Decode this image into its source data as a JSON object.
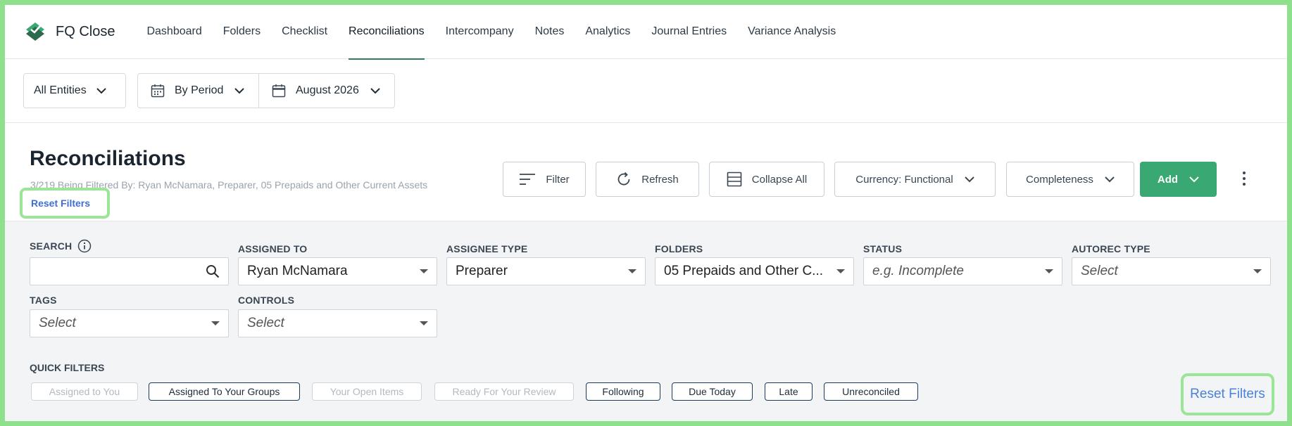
{
  "app": {
    "name": "FQ Close"
  },
  "nav": {
    "items": [
      {
        "label": "Dashboard"
      },
      {
        "label": "Folders"
      },
      {
        "label": "Checklist"
      },
      {
        "label": "Reconciliations"
      },
      {
        "label": "Intercompany"
      },
      {
        "label": "Notes"
      },
      {
        "label": "Analytics"
      },
      {
        "label": "Journal Entries"
      },
      {
        "label": "Variance Analysis"
      }
    ],
    "active": "Reconciliations"
  },
  "period_bar": {
    "entities": "All Entities",
    "mode": "By Period",
    "period": "August 2026"
  },
  "header": {
    "title": "Reconciliations",
    "filtered_by": "3/219 Being Filtered By: Ryan McNamara, Preparer, 05 Prepaids and Other Current Assets",
    "reset_filters": "Reset Filters"
  },
  "toolbar": {
    "filter": "Filter",
    "refresh": "Refresh",
    "collapse_all": "Collapse All",
    "currency": "Currency: Functional",
    "completeness": "Completeness",
    "add": "Add"
  },
  "filters": {
    "search": {
      "label": "SEARCH",
      "value": ""
    },
    "assigned_to": {
      "label": "ASSIGNED TO",
      "value": "Ryan McNamara"
    },
    "assignee_type": {
      "label": "ASSIGNEE TYPE",
      "value": "Preparer"
    },
    "folders": {
      "label": "FOLDERS",
      "value": "05 Prepaids and Other C..."
    },
    "status": {
      "label": "STATUS",
      "placeholder": "e.g. Incomplete"
    },
    "autorec_type": {
      "label": "AUTOREC TYPE",
      "placeholder": "Select"
    },
    "tags": {
      "label": "TAGS",
      "placeholder": "Select"
    },
    "controls": {
      "label": "CONTROLS",
      "placeholder": "Select"
    }
  },
  "quick_filters": {
    "label": "QUICK FILTERS",
    "chips": [
      {
        "label": "Assigned to You",
        "enabled": false
      },
      {
        "label": "Assigned To Your Groups",
        "enabled": true
      },
      {
        "label": "Your Open Items",
        "enabled": false
      },
      {
        "label": "Ready For Your Review",
        "enabled": false
      },
      {
        "label": "Following",
        "enabled": true
      },
      {
        "label": "Due Today",
        "enabled": true
      },
      {
        "label": "Late",
        "enabled": true
      },
      {
        "label": "Unreconciled",
        "enabled": true
      }
    ],
    "reset_filters": "Reset Filters"
  },
  "colors": {
    "accent_green": "#3aa872",
    "link_blue": "#3f6fd6",
    "highlight": "#9be596"
  }
}
